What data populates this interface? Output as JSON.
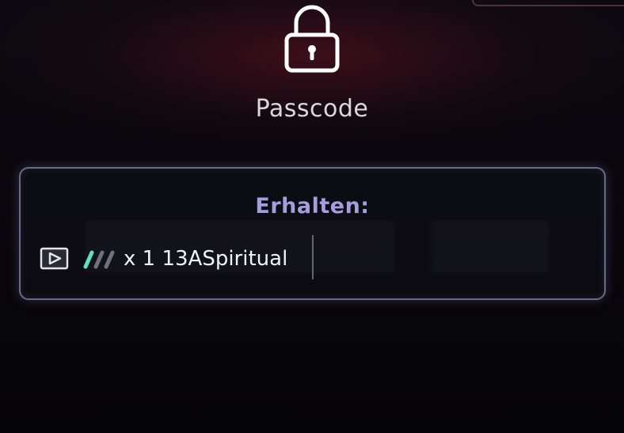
{
  "screen": {
    "title": "Passcode"
  },
  "reward_panel": {
    "header": "Erhalten:",
    "reward": {
      "text": "x 1 13ASpiritual",
      "icons": [
        "video-icon",
        "slash-marks-icon"
      ]
    }
  },
  "icons": {
    "lock": "lock-icon"
  },
  "colors": {
    "header": "#a79cde",
    "panel_border": "#6a6a86",
    "slash_accent": "#5fe0c4",
    "slash_muted": "#6f6f80",
    "background_glow": "#781428"
  }
}
